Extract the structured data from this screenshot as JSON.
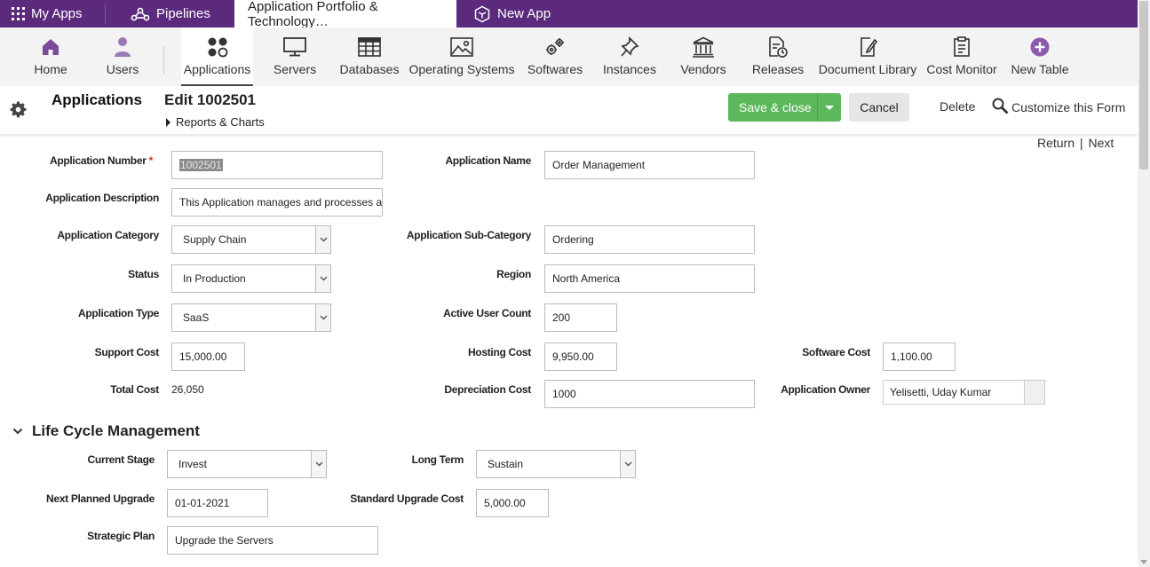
{
  "topbar": {
    "my_apps": "My Apps",
    "pipelines": "Pipelines",
    "active_tab": "Application Portfolio & Technology…",
    "new_app": "New App"
  },
  "nav": {
    "home": "Home",
    "users": "Users",
    "applications": "Applications",
    "servers": "Servers",
    "databases": "Databases",
    "operating_systems": "Operating Systems",
    "softwares": "Softwares",
    "instances": "Instances",
    "vendors": "Vendors",
    "releases": "Releases",
    "document_library": "Document Library",
    "cost_monitor": "Cost Monitor",
    "new_table": "New Table"
  },
  "header": {
    "title": "Applications",
    "edit_title": "Edit 1002501",
    "reports": "Reports & Charts",
    "save_close": "Save & close",
    "cancel": "Cancel",
    "delete": "Delete",
    "customize": "Customize this Form",
    "return": "Return",
    "next": "Next",
    "separator": "|"
  },
  "form": {
    "application_number": {
      "label": "Application Number",
      "required": "*",
      "value": "1002501"
    },
    "application_name": {
      "label": "Application Name",
      "value": "Order Management"
    },
    "application_description": {
      "label": "Application Description",
      "value": "This Application manages and processes al"
    },
    "application_category": {
      "label": "Application Category",
      "value": "Supply Chain"
    },
    "application_sub_category": {
      "label": "Application Sub-Category",
      "value": "Ordering"
    },
    "status": {
      "label": "Status",
      "value": "In Production"
    },
    "region": {
      "label": "Region",
      "value": "North America"
    },
    "application_type": {
      "label": "Application Type",
      "value": "SaaS"
    },
    "active_user_count": {
      "label": "Active User Count",
      "value": "200"
    },
    "support_cost": {
      "label": "Support Cost",
      "value": "15,000.00"
    },
    "hosting_cost": {
      "label": "Hosting Cost",
      "value": "9,950.00"
    },
    "software_cost": {
      "label": "Software Cost",
      "value": "1,100.00"
    },
    "total_cost": {
      "label": "Total Cost",
      "value": "26,050"
    },
    "depreciation_cost": {
      "label": "Depreciation Cost",
      "value": "1000"
    },
    "application_owner": {
      "label": "Application Owner",
      "value": "Yelisetti, Uday Kumar"
    }
  },
  "lifecycle": {
    "title": "Life Cycle Management",
    "current_stage": {
      "label": "Current Stage",
      "value": "Invest"
    },
    "long_term": {
      "label": "Long Term",
      "value": "Sustain"
    },
    "next_planned_upgrade": {
      "label": "Next Planned Upgrade",
      "value": "01-01-2021"
    },
    "standard_upgrade_cost": {
      "label": "Standard Upgrade Cost",
      "value": "5,000.00"
    },
    "strategic_plan": {
      "label": "Strategic Plan",
      "value": "Upgrade the Servers"
    }
  },
  "colors": {
    "topbar": "#5b2a7d",
    "nav_icon": "#7b4a9a",
    "save_button": "#5cb85c",
    "required": "#d9302c"
  }
}
